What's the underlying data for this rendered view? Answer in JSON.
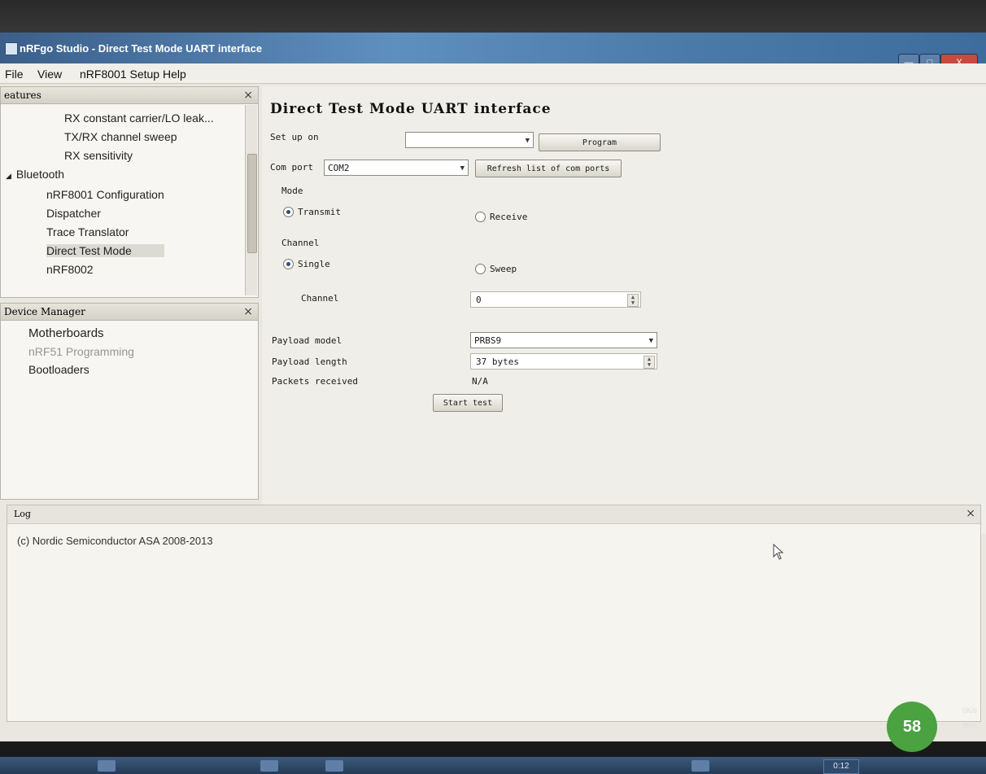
{
  "window": {
    "title": "nRFgo Studio - Direct Test Mode UART interface",
    "min_label": "—",
    "max_label": "□",
    "close_label": "X"
  },
  "menubar": [
    "File",
    "View",
    "nRF8001 Setup",
    "Help"
  ],
  "features": {
    "header": "eatures",
    "close": "×",
    "items": [
      "RX constant carrier/LO leak...",
      "TX/RX channel sweep",
      "RX sensitivity",
      "Bluetooth",
      "nRF8001 Configuration",
      "Dispatcher",
      "Trace Translator",
      "Direct Test Mode",
      "nRF8002"
    ],
    "expand_glyph": "◢"
  },
  "device_manager": {
    "header": "Device Manager",
    "close": "×",
    "items": [
      "Motherboards",
      "nRF51 Programming",
      "Bootloaders"
    ]
  },
  "dtm": {
    "heading": "Direct Test Mode UART interface",
    "setup_on_label": "Set up on",
    "setup_on_value": "",
    "program_button": "Program",
    "com_port_label": "Com port",
    "com_port_value": "COM2",
    "refresh_button": "Refresh list of com ports",
    "mode_label": "Mode",
    "transmit_label": "Transmit",
    "receive_label": "Receive",
    "channel_group_label": "Channel",
    "single_label": "Single",
    "sweep_label": "Sweep",
    "channel_label": "Channel",
    "channel_value": "0",
    "payload_model_label": "Payload model",
    "payload_model_value": "PRBS9",
    "payload_length_label": "Payload length",
    "payload_length_value": "37 bytes",
    "packets_received_label": "Packets received",
    "packets_received_value": "N/A",
    "start_button": "Start test"
  },
  "log": {
    "header": "Log",
    "close": "×",
    "text": "(c) Nordic Semiconductor ASA 2008-2013"
  },
  "taskbar": {
    "clock": "0:12"
  },
  "overlay": {
    "badge": "58",
    "net_up": "0K/s",
    "net_down": "0K/s"
  }
}
